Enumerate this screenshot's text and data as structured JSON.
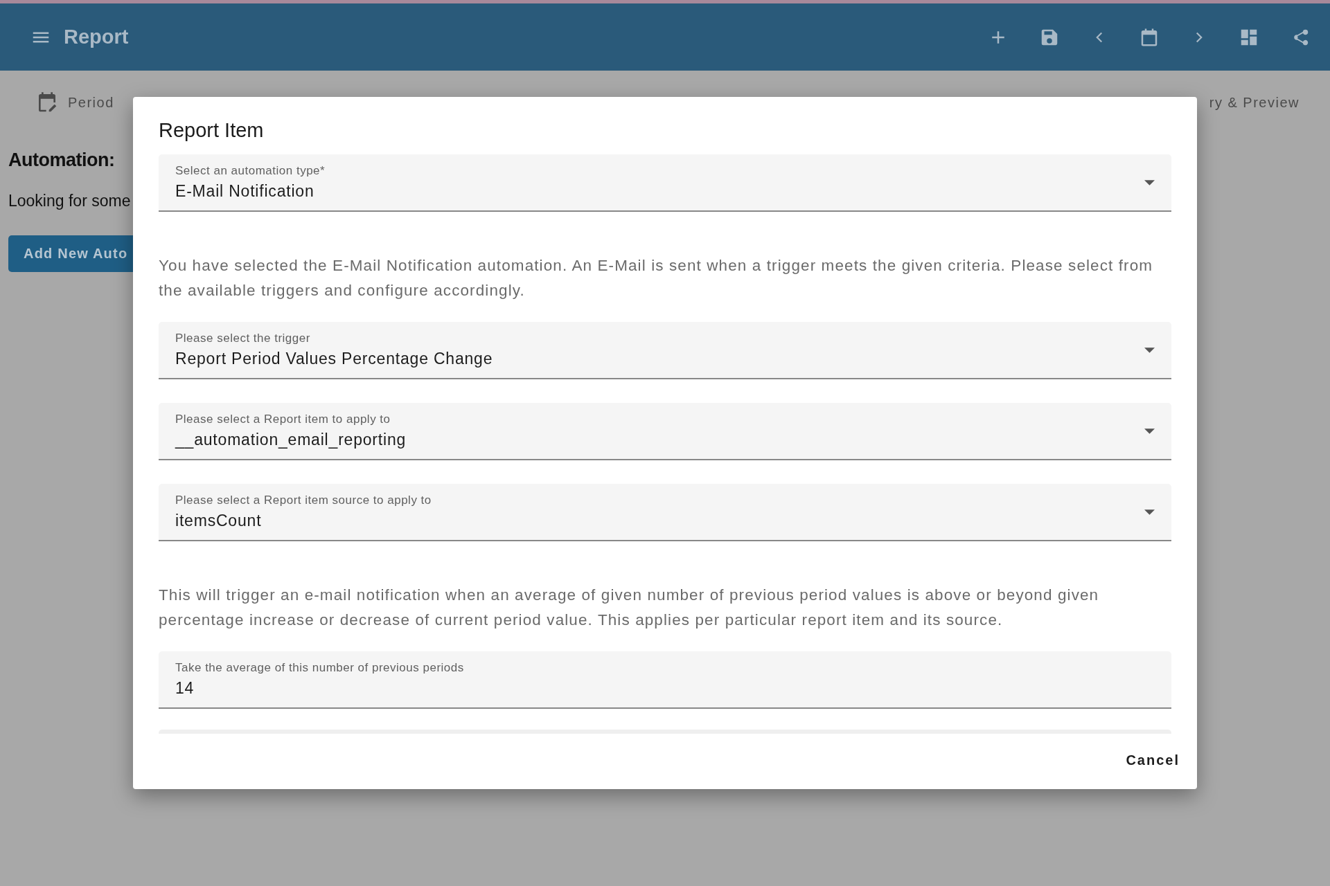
{
  "app_bar": {
    "title": "Report"
  },
  "tabs": [
    {
      "label": "Period"
    },
    {
      "label": "ry & Preview"
    }
  ],
  "page": {
    "heading": "Automation:",
    "text": "Looking for some",
    "button": "Add New Auto"
  },
  "dialog": {
    "title": "Report Item",
    "items": [
      {
        "kind": "select",
        "label": "Select an automation type*",
        "value": "E-Mail Notification"
      },
      {
        "kind": "paragraph",
        "text": "You have selected the E-Mail Notification automation. An E-Mail is sent when a trigger meets the given criteria. Please select from the available triggers and configure accordingly."
      },
      {
        "kind": "select",
        "label": "Please select the trigger",
        "value": "Report Period Values Percentage Change"
      },
      {
        "kind": "select",
        "label": "Please select a Report item to apply to",
        "value": "__automation_email_reporting"
      },
      {
        "kind": "select",
        "label": "Please select a Report item source to apply to",
        "value": "itemsCount"
      },
      {
        "kind": "paragraph",
        "text": "This will trigger an e-mail notification when an average of given number of previous period values is above or beyond given percentage increase or decrease of current period value. This applies per particular report item and its source."
      },
      {
        "kind": "input",
        "label": "Take the average of this number of previous periods",
        "value": "14"
      }
    ],
    "cancel": "Cancel"
  }
}
